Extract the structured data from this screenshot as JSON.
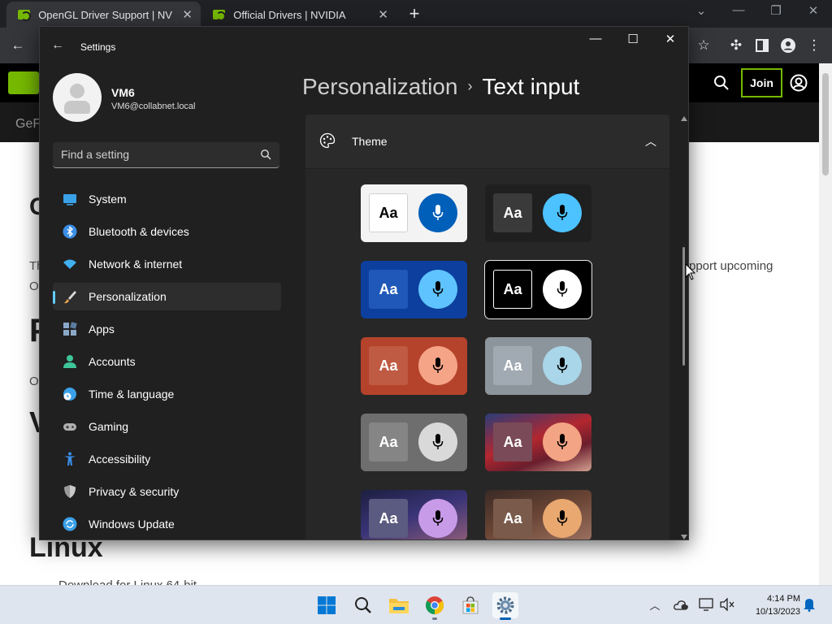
{
  "browser": {
    "tabs": [
      {
        "title": "OpenGL Driver Support | NVIDIA",
        "active": true
      },
      {
        "title": "Official Drivers | NVIDIA",
        "active": false
      }
    ],
    "new_tab": "+"
  },
  "webpage": {
    "join_label": "Join",
    "subnav_text": "GeF",
    "snippets": [
      {
        "text": "C"
      },
      {
        "text": "Th"
      },
      {
        "text": "pport upcoming"
      },
      {
        "text": "O"
      },
      {
        "text": "P"
      },
      {
        "text": "O"
      },
      {
        "text": "V"
      },
      {
        "text": "Linux"
      },
      {
        "text": "Download for Linux 64-bit"
      }
    ]
  },
  "settings": {
    "window_title": "Settings",
    "user": {
      "name": "VM6",
      "email": "VM6@collabnet.local"
    },
    "search_placeholder": "Find a setting",
    "nav": [
      {
        "label": "System",
        "icon": "system-icon",
        "color": "#3aa0e8"
      },
      {
        "label": "Bluetooth & devices",
        "icon": "bluetooth-icon",
        "color": "#3a8ee6"
      },
      {
        "label": "Network & internet",
        "icon": "wifi-icon",
        "color": "#41b0f0"
      },
      {
        "label": "Personalization",
        "icon": "paintbrush-icon",
        "color": "#e8a050",
        "active": true
      },
      {
        "label": "Apps",
        "icon": "apps-icon",
        "color": "#8aa8c8"
      },
      {
        "label": "Accounts",
        "icon": "accounts-icon",
        "color": "#3ec59a"
      },
      {
        "label": "Time & language",
        "icon": "time-language-icon",
        "color": "#3aa0e8"
      },
      {
        "label": "Gaming",
        "icon": "gaming-icon",
        "color": "#b0b0b0"
      },
      {
        "label": "Accessibility",
        "icon": "accessibility-icon",
        "color": "#3a8ee6"
      },
      {
        "label": "Privacy & security",
        "icon": "shield-icon",
        "color": "#9a9a9a"
      },
      {
        "label": "Windows Update",
        "icon": "windows-update-icon",
        "color": "#3aa0e8"
      }
    ],
    "breadcrumb": {
      "parent": "Personalization",
      "separator": "›",
      "current": "Text input"
    },
    "theme_section": {
      "label": "Theme",
      "expanded": true
    },
    "theme_swatches": [
      {
        "name": "light",
        "aa_bg": "#ffffff",
        "aa_fg": "#000000",
        "mic_bg": "#005fb8",
        "mic_fg": "#ffffff",
        "card_bg": "#f3f3f3"
      },
      {
        "name": "dark",
        "aa_bg": "#3a3a3a",
        "aa_fg": "#ffffff",
        "mic_bg": "#4cc2ff",
        "mic_fg": "#000000",
        "card_bg": "#1f1f1f"
      },
      {
        "name": "blue",
        "aa_bg": "#1f58b8",
        "aa_fg": "#ffffff",
        "mic_bg": "#5fc3ff",
        "mic_fg": "#000000",
        "card_bg": "#0d3f9e"
      },
      {
        "name": "high-contrast",
        "aa_bg": "#000000",
        "aa_fg": "#ffffff",
        "mic_bg": "#ffffff",
        "mic_fg": "#000000",
        "card_bg": "#000000",
        "selected": true
      },
      {
        "name": "orange",
        "aa_bg": "#bf5a43",
        "aa_fg": "#ffffff",
        "mic_bg": "#f5a488",
        "mic_fg": "#000000",
        "card_bg": "#b5432b"
      },
      {
        "name": "slate",
        "aa_bg": "#a1a9b2",
        "aa_fg": "#ffffff",
        "mic_bg": "#a9d6e8",
        "mic_fg": "#000000",
        "card_bg": "#8c949c"
      },
      {
        "name": "gray",
        "aa_bg": "#858585",
        "aa_fg": "#ffffff",
        "mic_bg": "#d9d9d9",
        "mic_fg": "#000000",
        "card_bg": "#6e6e6e"
      },
      {
        "name": "red-flow",
        "aa_bg": "#7a4a58",
        "aa_fg": "#ffffff",
        "mic_bg": "#f3a484",
        "mic_fg": "#000000",
        "card_bg": "linear-gradient(160deg,#2b3d78 0%,#b3272f 45%,#6a1e2d 70%,#d3a090 100%)"
      },
      {
        "name": "purple-flow",
        "aa_bg": "#5b5a80",
        "aa_fg": "#ffffff",
        "mic_bg": "#c89be8",
        "mic_fg": "#000000",
        "card_bg": "linear-gradient(160deg,#1c1f40 0%,#3a3477 50%,#8a5a78 100%)"
      },
      {
        "name": "earth-flow",
        "aa_bg": "#7a5a4a",
        "aa_fg": "#ffffff",
        "mic_bg": "#e8a870",
        "mic_fg": "#000000",
        "card_bg": "linear-gradient(160deg,#3a2a25 0%,#6a4535 50%,#9a7060 100%)"
      }
    ],
    "swatch_aa_label": "Aa"
  },
  "taskbar": {
    "time": "4:14 PM",
    "date": "10/13/2023",
    "apps": [
      "windows-start-icon",
      "search-icon",
      "file-explorer-icon",
      "chrome-icon",
      "microsoft-store-icon",
      "settings-gear-icon"
    ]
  }
}
